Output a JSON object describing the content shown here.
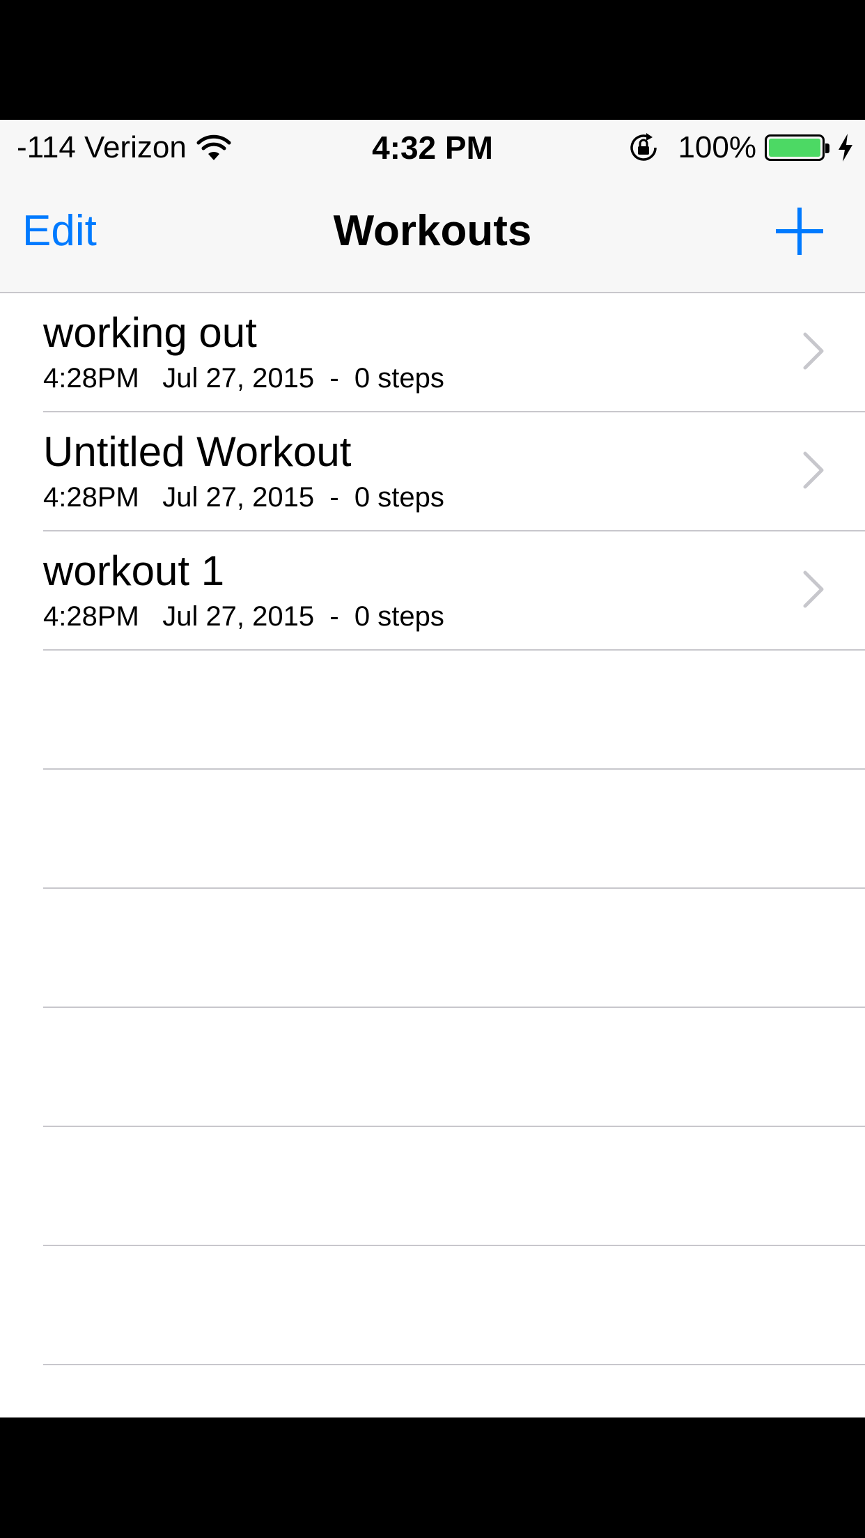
{
  "status_bar": {
    "carrier": "-114 Verizon",
    "time": "4:32 PM",
    "battery_percent": "100%",
    "battery_level": 1.0,
    "battery_color": "#4cd964"
  },
  "nav_bar": {
    "edit_label": "Edit",
    "title": "Workouts",
    "add_icon": "plus-icon",
    "accent_color": "#007aff"
  },
  "workouts": [
    {
      "title": "working out",
      "subtitle": "4:28PM   Jul 27, 2015  -  0 steps"
    },
    {
      "title": "Untitled Workout",
      "subtitle": "4:28PM   Jul 27, 2015  -  0 steps"
    },
    {
      "title": "workout 1",
      "subtitle": "4:28PM   Jul 27, 2015  -  0 steps"
    }
  ]
}
